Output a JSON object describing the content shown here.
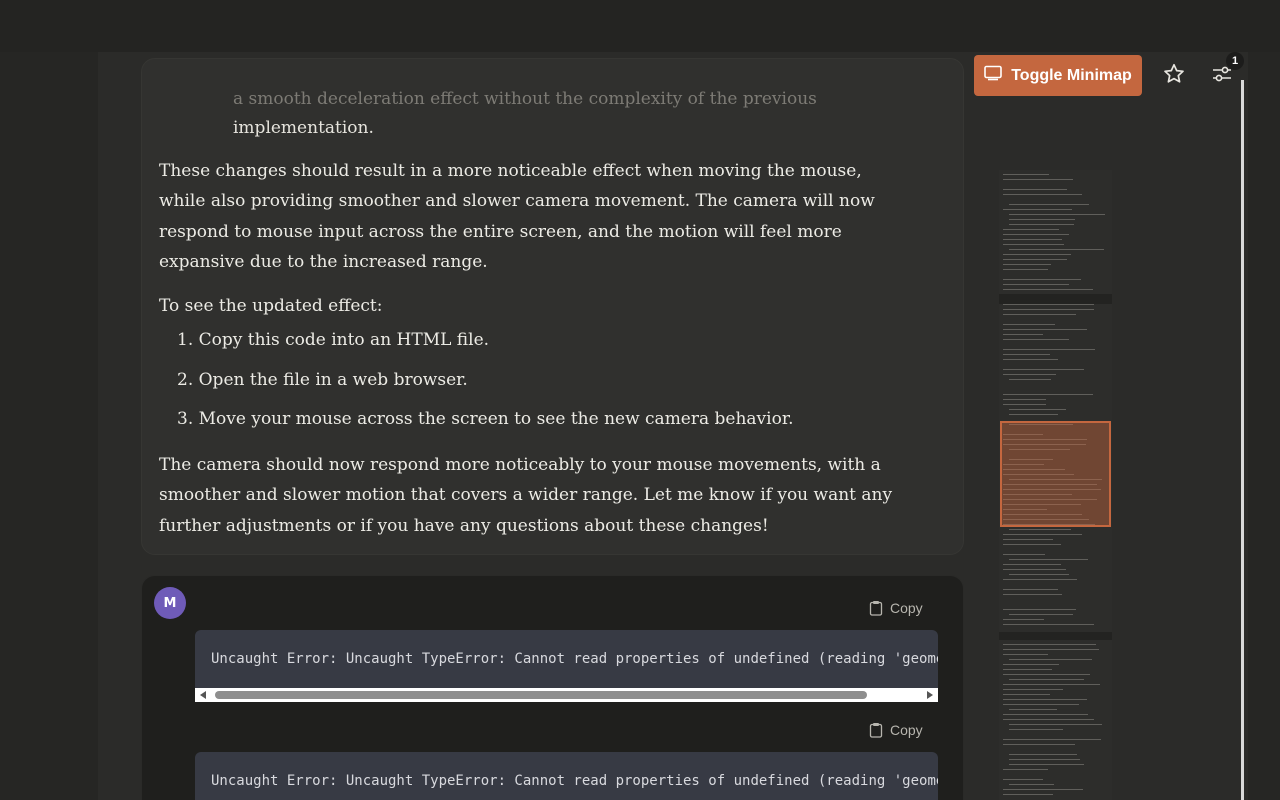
{
  "assistant_message": {
    "faded_line": "a smooth deceleration effect without the complexity of the previous",
    "continuation": "implementation.",
    "paragraph1": "These changes should result in a more noticeable effect when moving the mouse, while also providing smoother and slower camera movement. The camera will now respond to mouse input across the entire screen, and the motion will feel more expansive due to the increased range.",
    "paragraph2": "To see the updated effect:",
    "steps": [
      "1. Copy this code into an HTML file.",
      "2. Open the file in a web browser.",
      "3. Move your mouse across the screen to see the new camera behavior."
    ],
    "paragraph3": "The camera should now respond more noticeably to your mouse movements, with a smoother and slower motion that covers a wider range. Let me know if you want any further adjustments or if you have any questions about these changes!"
  },
  "user_message": {
    "avatar_initial": "M",
    "copy_label": "Copy",
    "code_lines": [
      "Uncaught Error: Uncaught TypeError: Cannot read properties of undefined (reading 'geometry')",
      "Uncaught Error: Uncaught TypeError: Cannot read properties of undefined (reading 'geometry')"
    ]
  },
  "toolbar": {
    "toggle_minimap_label": "Toggle Minimap",
    "badge_count": "1",
    "accent_color": "#c4673f"
  },
  "icons": [
    "minimap-icon",
    "star-icon",
    "settings-sliders-icon",
    "clipboard-icon"
  ]
}
